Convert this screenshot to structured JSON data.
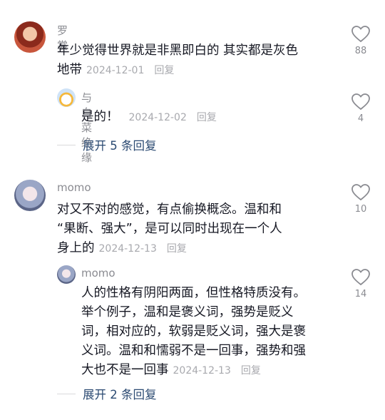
{
  "comments": [
    {
      "author": "罗裳",
      "lines": [
        "年少觉得世界就是非黑即白的 其实都是灰色",
        "地带"
      ],
      "date": "2024-12-01",
      "reply_label": "回复",
      "likes": "88"
    },
    {
      "author": "与白菜绝缘",
      "lines": [
        "是的！"
      ],
      "date": "2024-12-02",
      "reply_label": "回复",
      "likes": "4"
    },
    {
      "author": "momo",
      "lines": [
        "对又不对的感觉，有点偷换概念。温和和",
        "“果断、强大”，是可以同时出现在一个人",
        "身上的"
      ],
      "date": "2024-12-13",
      "reply_label": "回复",
      "likes": "10"
    },
    {
      "author": "momo",
      "lines": [
        "人的性格有阴阳两面，但性格特质没有。",
        "举个例子，温和是褒义词，强势是贬义",
        "词，相对应的，软弱是贬义词，强大是褒",
        "义词。温和和懦弱不是一回事，强势和强",
        "大也不是一回事"
      ],
      "date": "2024-12-13",
      "reply_label": "回复",
      "likes": "14"
    }
  ],
  "expand": [
    "展开 5 条回复",
    "展开 2 条回复"
  ],
  "icons": {
    "like": "heart-outline-icon"
  }
}
